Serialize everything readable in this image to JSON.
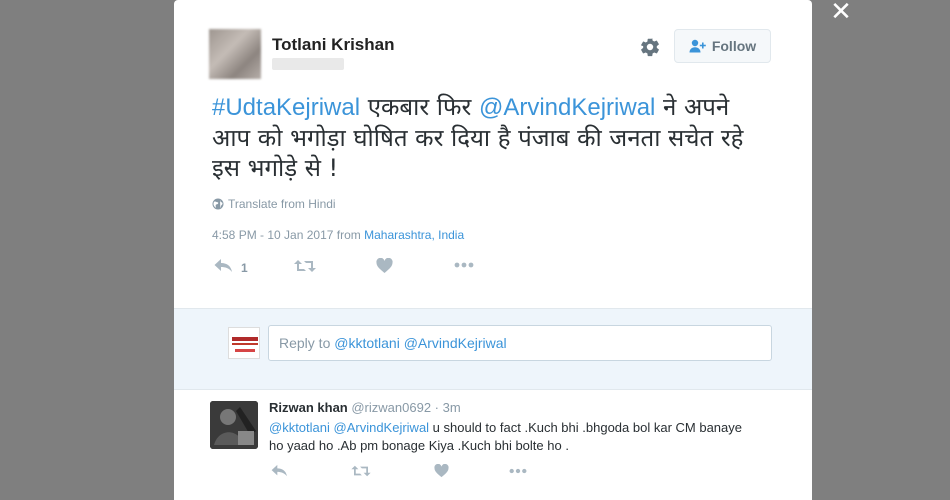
{
  "overlay": {
    "close_label": "✕"
  },
  "tweet": {
    "author_name": "Totlani Krishan",
    "follow_label": "Follow",
    "hashtag": "#UdtaKejriwal",
    "text_part1": " एकबार फिर ",
    "mention": "@ArvindKejriwal",
    "text_part2": " ने अपने आप को भगोड़ा घोषित कर दिया है पंजाब की जनता सचेत रहे इस भगोड़े से !",
    "translate_label": "Translate from Hindi",
    "timestamp": "4:58 PM - 10 Jan 2017 from ",
    "location": "Maharashtra, India",
    "reply_count": "1"
  },
  "reply_box": {
    "prefix": "Reply to ",
    "mentions": "@kktotlani @ArvindKejriwal"
  },
  "reply": {
    "name": "Rizwan khan",
    "handle_time": " @rizwan0692 · 3m",
    "mentions": "@kktotlani @ArvindKejriwal",
    "text": " u should to fact .Kuch bhi .bhgoda bol kar CM banaye ho yaad ho .Ab pm bonage Kiya .Kuch bhi bolte ho ."
  },
  "colors": {
    "link": "#3b94d9",
    "muted": "#8899a6",
    "overlay": "#7f7f7f"
  }
}
